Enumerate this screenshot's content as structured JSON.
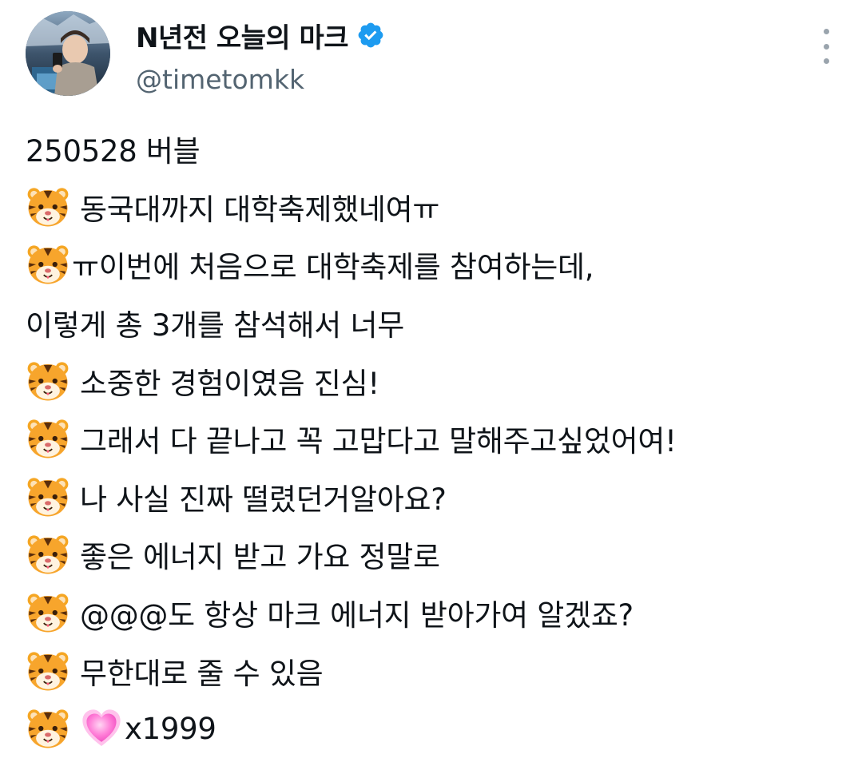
{
  "author": {
    "display_name": "N년전 오늘의 마크",
    "handle": "@timetomkk",
    "verified": true,
    "avatar_icon": "profile-photo"
  },
  "colors": {
    "verified_blue": "#1d9bf0",
    "handle_gray": "#536471",
    "text": "#0f1419",
    "heart_pink": "#ff6fd0"
  },
  "post": {
    "lines": [
      {
        "emoji": "",
        "text": "250528 버블"
      },
      {
        "emoji": "tiger-face",
        "text": "동국대까지 대학축제했네여ㅠ"
      },
      {
        "emoji": "tiger-face",
        "text": "ㅠ이번에 처음으로 대학축제를 참여하는데,"
      },
      {
        "emoji": "",
        "text": "이렇게 총 3개를 참석해서 너무"
      },
      {
        "emoji": "tiger-face",
        "text": "소중한 경험이였음 진심!"
      },
      {
        "emoji": "tiger-face",
        "text": "그래서 다 끝나고 꼭 고맙다고 말해주고싶었어여!"
      },
      {
        "emoji": "tiger-face",
        "text": "나 사실 진짜 떨렸던거알아요?"
      },
      {
        "emoji": "tiger-face",
        "text": "좋은 에너지 받고 가요 정말로"
      },
      {
        "emoji": "tiger-face",
        "text": "@@@도 항상 마크 에너지 받아가여 알겠죠?"
      },
      {
        "emoji": "tiger-face",
        "text": "무한대로 줄 수 있음"
      },
      {
        "emoji": "tiger-face",
        "heart": "growing-heart",
        "text": "x1999"
      }
    ]
  }
}
